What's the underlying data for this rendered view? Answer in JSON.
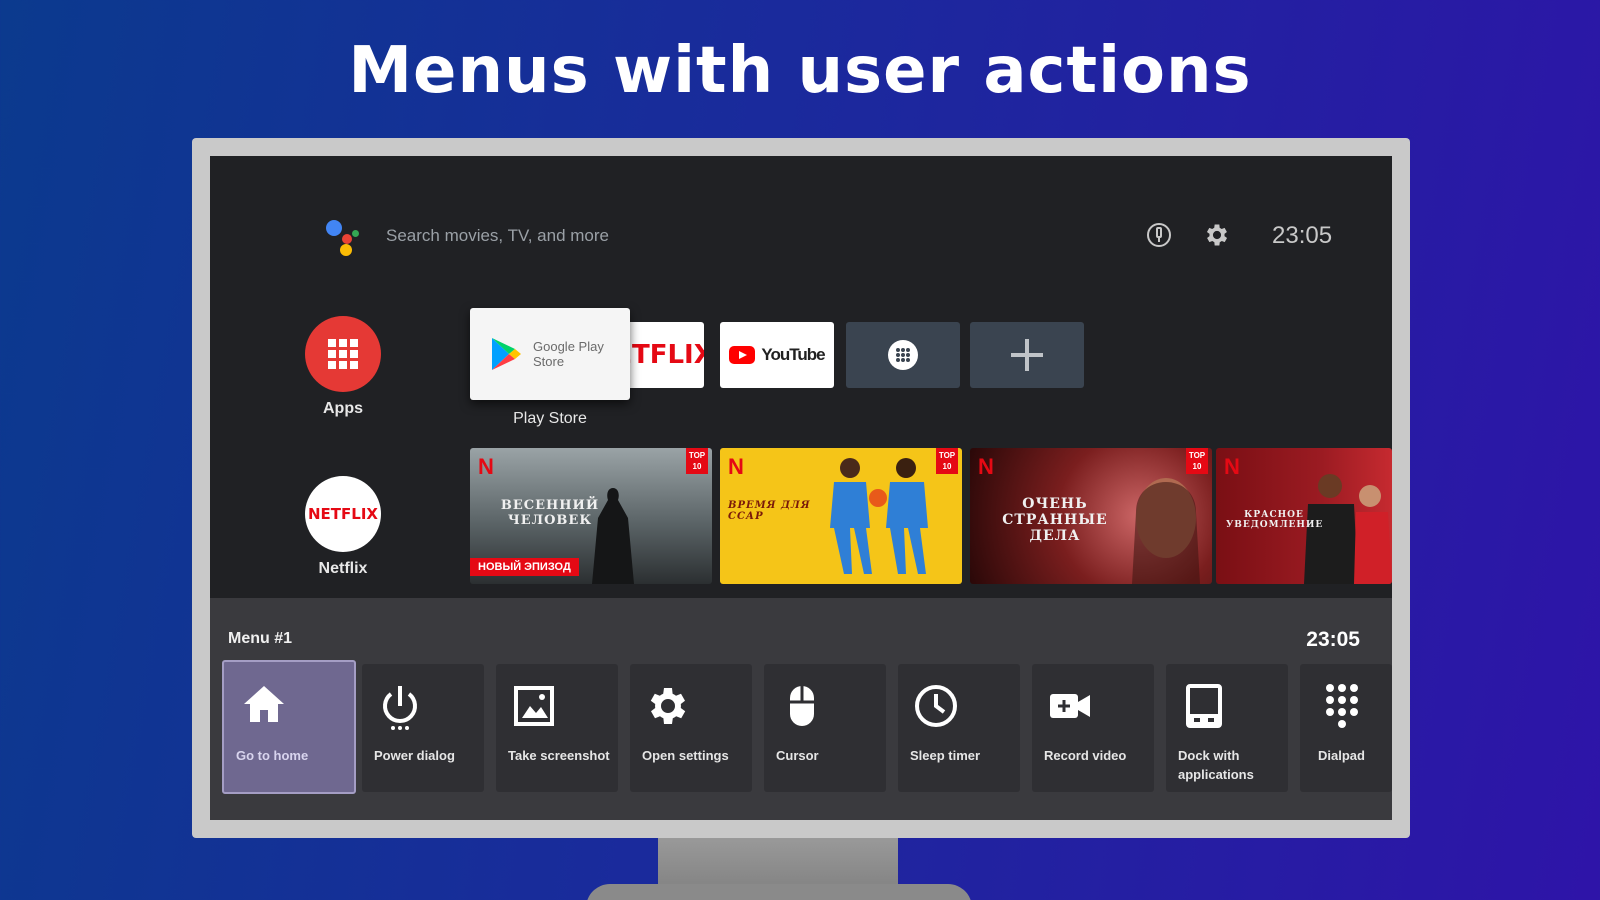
{
  "headline": "Menus with user actions",
  "topbar": {
    "search_placeholder": "Search movies, TV, and more",
    "clock": "23:05",
    "icons": [
      "assistant-icon",
      "input-icon",
      "settings-icon"
    ]
  },
  "side": {
    "apps_label": "Apps",
    "netflix_label": "Netflix",
    "netflix_logo": "NETFLIX"
  },
  "apps_row": {
    "focused_name": "Google Play Store",
    "focused_label": "Play Store",
    "netflix_text": "ETFLIX",
    "youtube_text": "YouTube",
    "more_icon": "grid-dots-icon",
    "add_icon": "plus-icon"
  },
  "posters": [
    {
      "title": "ВЕСЕННИЙ ЧЕЛОВЕК",
      "badge": "НОВЫЙ ЭПИЗОД",
      "top10": "TOP 10"
    },
    {
      "title": "ВРЕМЯ ДЛЯ ССАР",
      "top10": "TOP 10"
    },
    {
      "title": "ОЧЕНЬ СТРАННЫЕ ДЕЛА",
      "top10": "TOP 10"
    },
    {
      "title": "КРАСНОЕ УВЕДОМЛЕНИЕ"
    }
  ],
  "menu": {
    "title": "Menu #1",
    "clock": "23:05",
    "items": [
      {
        "label": "Go to home",
        "icon": "home-icon"
      },
      {
        "label": "Power dialog",
        "icon": "power-icon"
      },
      {
        "label": "Take screenshot",
        "icon": "screenshot-icon"
      },
      {
        "label": "Open settings",
        "icon": "gear-icon"
      },
      {
        "label": "Cursor",
        "icon": "mouse-icon"
      },
      {
        "label": "Sleep timer",
        "icon": "clock-icon"
      },
      {
        "label": "Record video",
        "icon": "video-camera-icon"
      },
      {
        "label": "Dock with applications",
        "icon": "dock-icon"
      },
      {
        "label": "Dialpad",
        "icon": "dialpad-icon"
      }
    ]
  },
  "colors": {
    "netflix_red": "#e50914",
    "menu_active": "#6f6890",
    "screen_bg": "#202124"
  }
}
